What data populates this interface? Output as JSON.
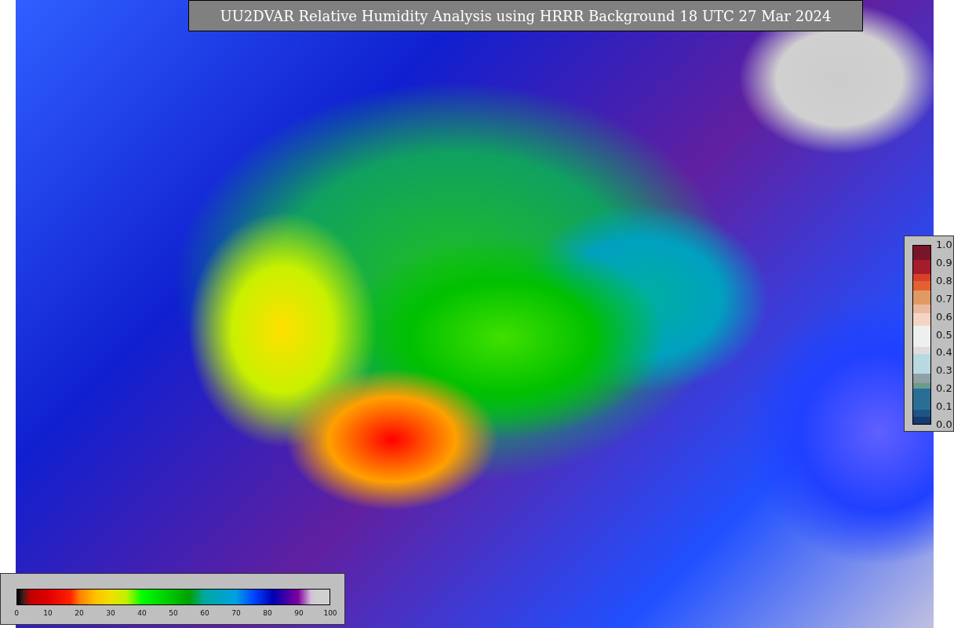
{
  "title": "UU2DVAR Relative Humidity Analysis using HRRR Background 18 UTC 27 Mar 2024",
  "right_colorbar": {
    "ticks": [
      "1.0",
      "0.9",
      "0.8",
      "0.7",
      "0.6",
      "0.5",
      "0.4",
      "0.3",
      "0.2",
      "0.1",
      "0.0"
    ]
  },
  "bottom_colorbar": {
    "ticks": [
      "0",
      "10",
      "20",
      "30",
      "40",
      "50",
      "60",
      "70",
      "80",
      "90",
      "100"
    ]
  }
}
